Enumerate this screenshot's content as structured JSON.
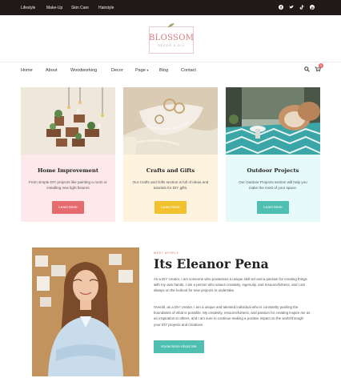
{
  "topbar": {
    "links": [
      "Lifestyle",
      "Make-Up",
      "Skin Care",
      "Hairstyle"
    ],
    "social_icons": [
      "facebook-icon",
      "twitter-icon",
      "tiktok-icon",
      "pinterest-icon"
    ]
  },
  "logo": {
    "name": "BLOSSOM",
    "tagline": "DECOR & DIY",
    "color": "#d7797d"
  },
  "nav": {
    "items": [
      "Home",
      "About",
      "Woodworking",
      "Decor",
      "Page",
      "Blog",
      "Contact"
    ],
    "page_caret": "▾",
    "cart_count": "0"
  },
  "cards": [
    {
      "title": "Home Improvement",
      "description": "From simple DIY projects like painting a room or installing new light fixtures",
      "button": "Learn More",
      "bg": "#fde8ec",
      "button_color": "#e56b6f"
    },
    {
      "title": "Crafts and Gifts",
      "description": "Our Crafts and Gifts section is full of ideas and tutorials for DIY gifts.",
      "button": "Learn More",
      "bg": "#fdf3df",
      "button_color": "#f2c12e"
    },
    {
      "title": "Outdoor Projects",
      "description": "Our Outdoor Projects section will help you make the most of your space.",
      "button": "Learn More",
      "bg": "#e6fafa",
      "button_color": "#4fbfb2"
    }
  ],
  "about": {
    "kicker": "MEET MYSELF",
    "title": "Its Eleanor Pena",
    "paragraph1": "As a DIY creator, I am someone who possesses a unique skill set and a passion for creating things with my own hands. I am a person who values creativity, ingenuity, and resourcefulness, and I am always on the lookout for new projects to undertake.",
    "paragraph2": "Overall, as a DIY creator, I am a unique and talented individual who is constantly pushing the boundaries of what is possible. My creativity, resourcefulness, and passion for creating inspire me as an inspiration to others, and I am sure to continue making a positive impact on the world through your DIY projects and creations.",
    "button": "Know More About Me"
  }
}
